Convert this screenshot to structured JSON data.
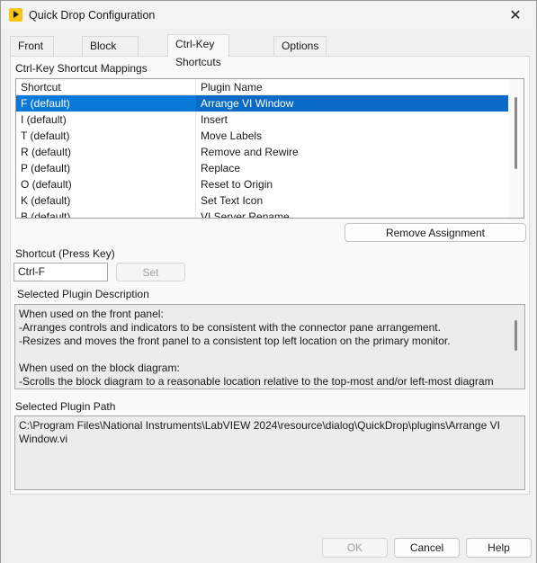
{
  "window": {
    "title": "Quick Drop Configuration",
    "close_label": "✕"
  },
  "tabs": [
    {
      "label": "Front Panel",
      "active": false
    },
    {
      "label": "Block Diagram",
      "active": false
    },
    {
      "label": "Ctrl-Key Shortcuts",
      "active": true
    },
    {
      "label": "Options",
      "active": false
    }
  ],
  "mappings": {
    "group_label": "Ctrl-Key Shortcut Mappings",
    "columns": [
      "Shortcut",
      "Plugin Name"
    ],
    "rows": [
      {
        "shortcut": "F (default)",
        "plugin": "Arrange VI Window",
        "selected": true
      },
      {
        "shortcut": "I (default)",
        "plugin": "Insert",
        "selected": false
      },
      {
        "shortcut": "T (default)",
        "plugin": "Move Labels",
        "selected": false
      },
      {
        "shortcut": "R (default)",
        "plugin": "Remove and Rewire",
        "selected": false
      },
      {
        "shortcut": "P (default)",
        "plugin": "Replace",
        "selected": false
      },
      {
        "shortcut": "O (default)",
        "plugin": "Reset to Origin",
        "selected": false
      },
      {
        "shortcut": "K (default)",
        "plugin": "Set Text Icon",
        "selected": false
      },
      {
        "shortcut": "B (default)",
        "plugin": "VI Server Rename",
        "selected": false
      }
    ],
    "remove_button": "Remove Assignment"
  },
  "shortcut": {
    "label": "Shortcut (Press Key)",
    "value": "Ctrl-F",
    "set_button": "Set"
  },
  "description": {
    "label": "Selected Plugin Description",
    "lines": [
      "When used on the front panel:",
      "-Arranges controls and indicators to be consistent with the connector pane arrangement.",
      "-Resizes and moves the front panel to a consistent top left location on the primary monitor.",
      "",
      "When used on the block diagram:",
      "-Scrolls the block diagram to a reasonable location relative to the top-most and/or left-most diagram"
    ]
  },
  "path": {
    "label": "Selected Plugin Path",
    "lines": [
      "C:\\Program Files\\National Instruments\\LabVIEW 2024\\resource\\dialog\\QuickDrop\\plugins\\Arrange VI",
      "Window.vi"
    ]
  },
  "footer": {
    "ok": "OK",
    "cancel": "Cancel",
    "help": "Help"
  },
  "colors": {
    "selection": "#0a78d7"
  }
}
